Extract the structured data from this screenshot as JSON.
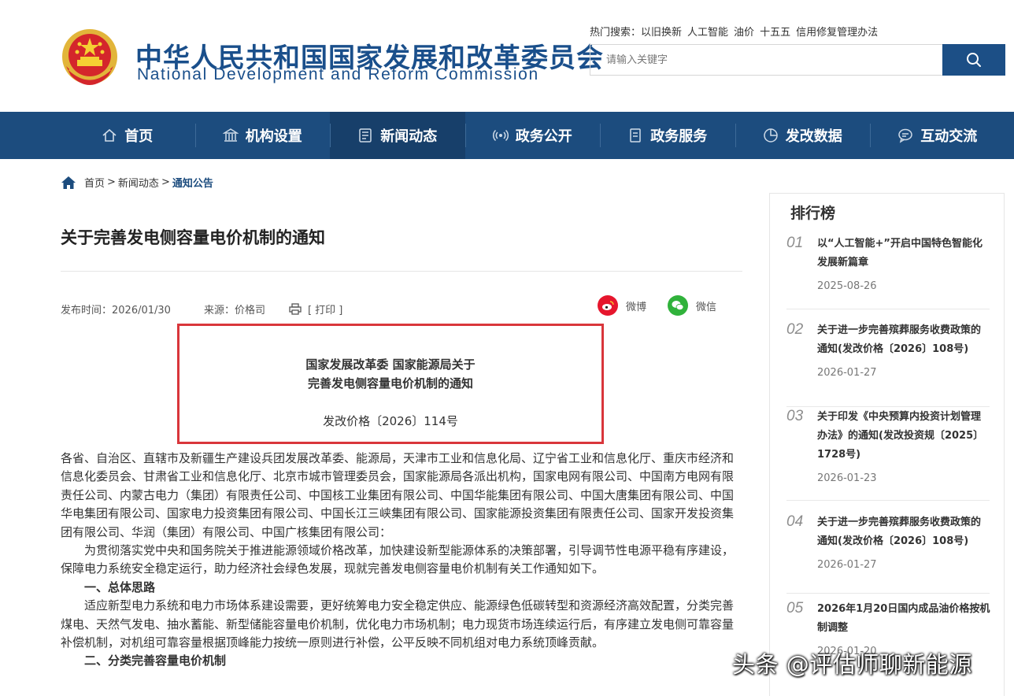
{
  "header": {
    "title_cn": "中华人民共和国国家发展和改革委员会",
    "title_en": "National Development and Reform Commission",
    "hot_search_label": "热门搜索：",
    "hot_search_terms": [
      "以旧换新",
      "人工智能",
      "油价",
      "十五五",
      "信用修复管理办法"
    ],
    "search_placeholder": "请输入关键字"
  },
  "nav": [
    {
      "label": "首页",
      "icon": "home-icon"
    },
    {
      "label": "机构设置",
      "icon": "building-icon"
    },
    {
      "label": "新闻动态",
      "icon": "news-icon",
      "active": true
    },
    {
      "label": "政务公开",
      "icon": "broadcast-icon"
    },
    {
      "label": "政务服务",
      "icon": "document-icon"
    },
    {
      "label": "发改数据",
      "icon": "pie-chart-icon"
    },
    {
      "label": "互动交流",
      "icon": "chat-icon"
    }
  ],
  "breadcrumb": {
    "home": "首页",
    "sep": ">",
    "section": "新闻动态",
    "current": "通知公告"
  },
  "article": {
    "title": "关于完善发电侧容量电价机制的通知",
    "publish_time": "发布时间：2026/01/30",
    "source": "来源：价格司",
    "print": "[ 打印 ]",
    "share_weibo": "微博",
    "share_wechat": "微信",
    "doc_line1": "国家发展改革委 国家能源局关于",
    "doc_line2": "完善发电侧容量电价机制的通知",
    "doc_number": "发改价格〔2026〕114号",
    "addressee": "各省、自治区、直辖市及新疆生产建设兵团发展改革委、能源局，天津市工业和信息化局、辽宁省工业和信息化厅、重庆市经济和信息化委员会、甘肃省工业和信息化厅、北京市城市管理委员会，国家能源局各派出机构，国家电网有限公司、中国南方电网有限责任公司、内蒙古电力（集团）有限责任公司、中国核工业集团有限公司、中国华能集团有限公司、中国大唐集团有限公司、中国华电集团有限公司、国家电力投资集团有限公司、中国长江三峡集团有限公司、国家能源投资集团有限责任公司、国家开发投资集团有限公司、华润（集团）有限公司、中国广核集团有限公司：",
    "para1": "为贯彻落实党中央和国务院关于推进能源领域价格改革，加快建设新型能源体系的决策部署，引导调节性电源平稳有序建设，保障电力系统安全稳定运行，助力经济社会绿色发展，现就完善发电侧容量电价机制有关工作通知如下。",
    "heading1": "一、总体思路",
    "para2": "适应新型电力系统和电力市场体系建设需要，更好统筹电力安全稳定供应、能源绿色低碳转型和资源经济高效配置，分类完善煤电、天然气发电、抽水蓄能、新型储能容量电价机制，优化电力市场机制；电力现货市场连续运行后，有序建立发电侧可靠容量补偿机制，对机组可靠容量根据顶峰能力按统一原则进行补偿，公平反映不同机组对电力系统顶峰贡献。",
    "heading2": "二、分类完善容量电价机制"
  },
  "sidebar": {
    "title": "排行榜",
    "items": [
      {
        "num": "01",
        "title": "以“人工智能+”开启中国特色智能化发展新篇章",
        "date": "2025-08-26"
      },
      {
        "num": "02",
        "title": "关于进一步完善殡葬服务收费政策的通知(发改价格〔2026〕108号)",
        "date": "2026-01-27"
      },
      {
        "num": "03",
        "title": "关于印发《中央预算内投资计划管理办法》的通知(发改投资规〔2025〕1728号)",
        "date": "2026-01-23"
      },
      {
        "num": "04",
        "title": "关于进一步完善殡葬服务收费政策的通知(发改价格〔2026〕108号)",
        "date": "2026-01-27"
      },
      {
        "num": "05",
        "title": "2026年1月20日国内成品油价格按机制调整",
        "date": "2026-01-20"
      }
    ]
  },
  "watermark": "头条 @评估师聊新能源",
  "colors": {
    "brand_blue": "#1c4c7e",
    "highlight_red": "#d9363b"
  }
}
